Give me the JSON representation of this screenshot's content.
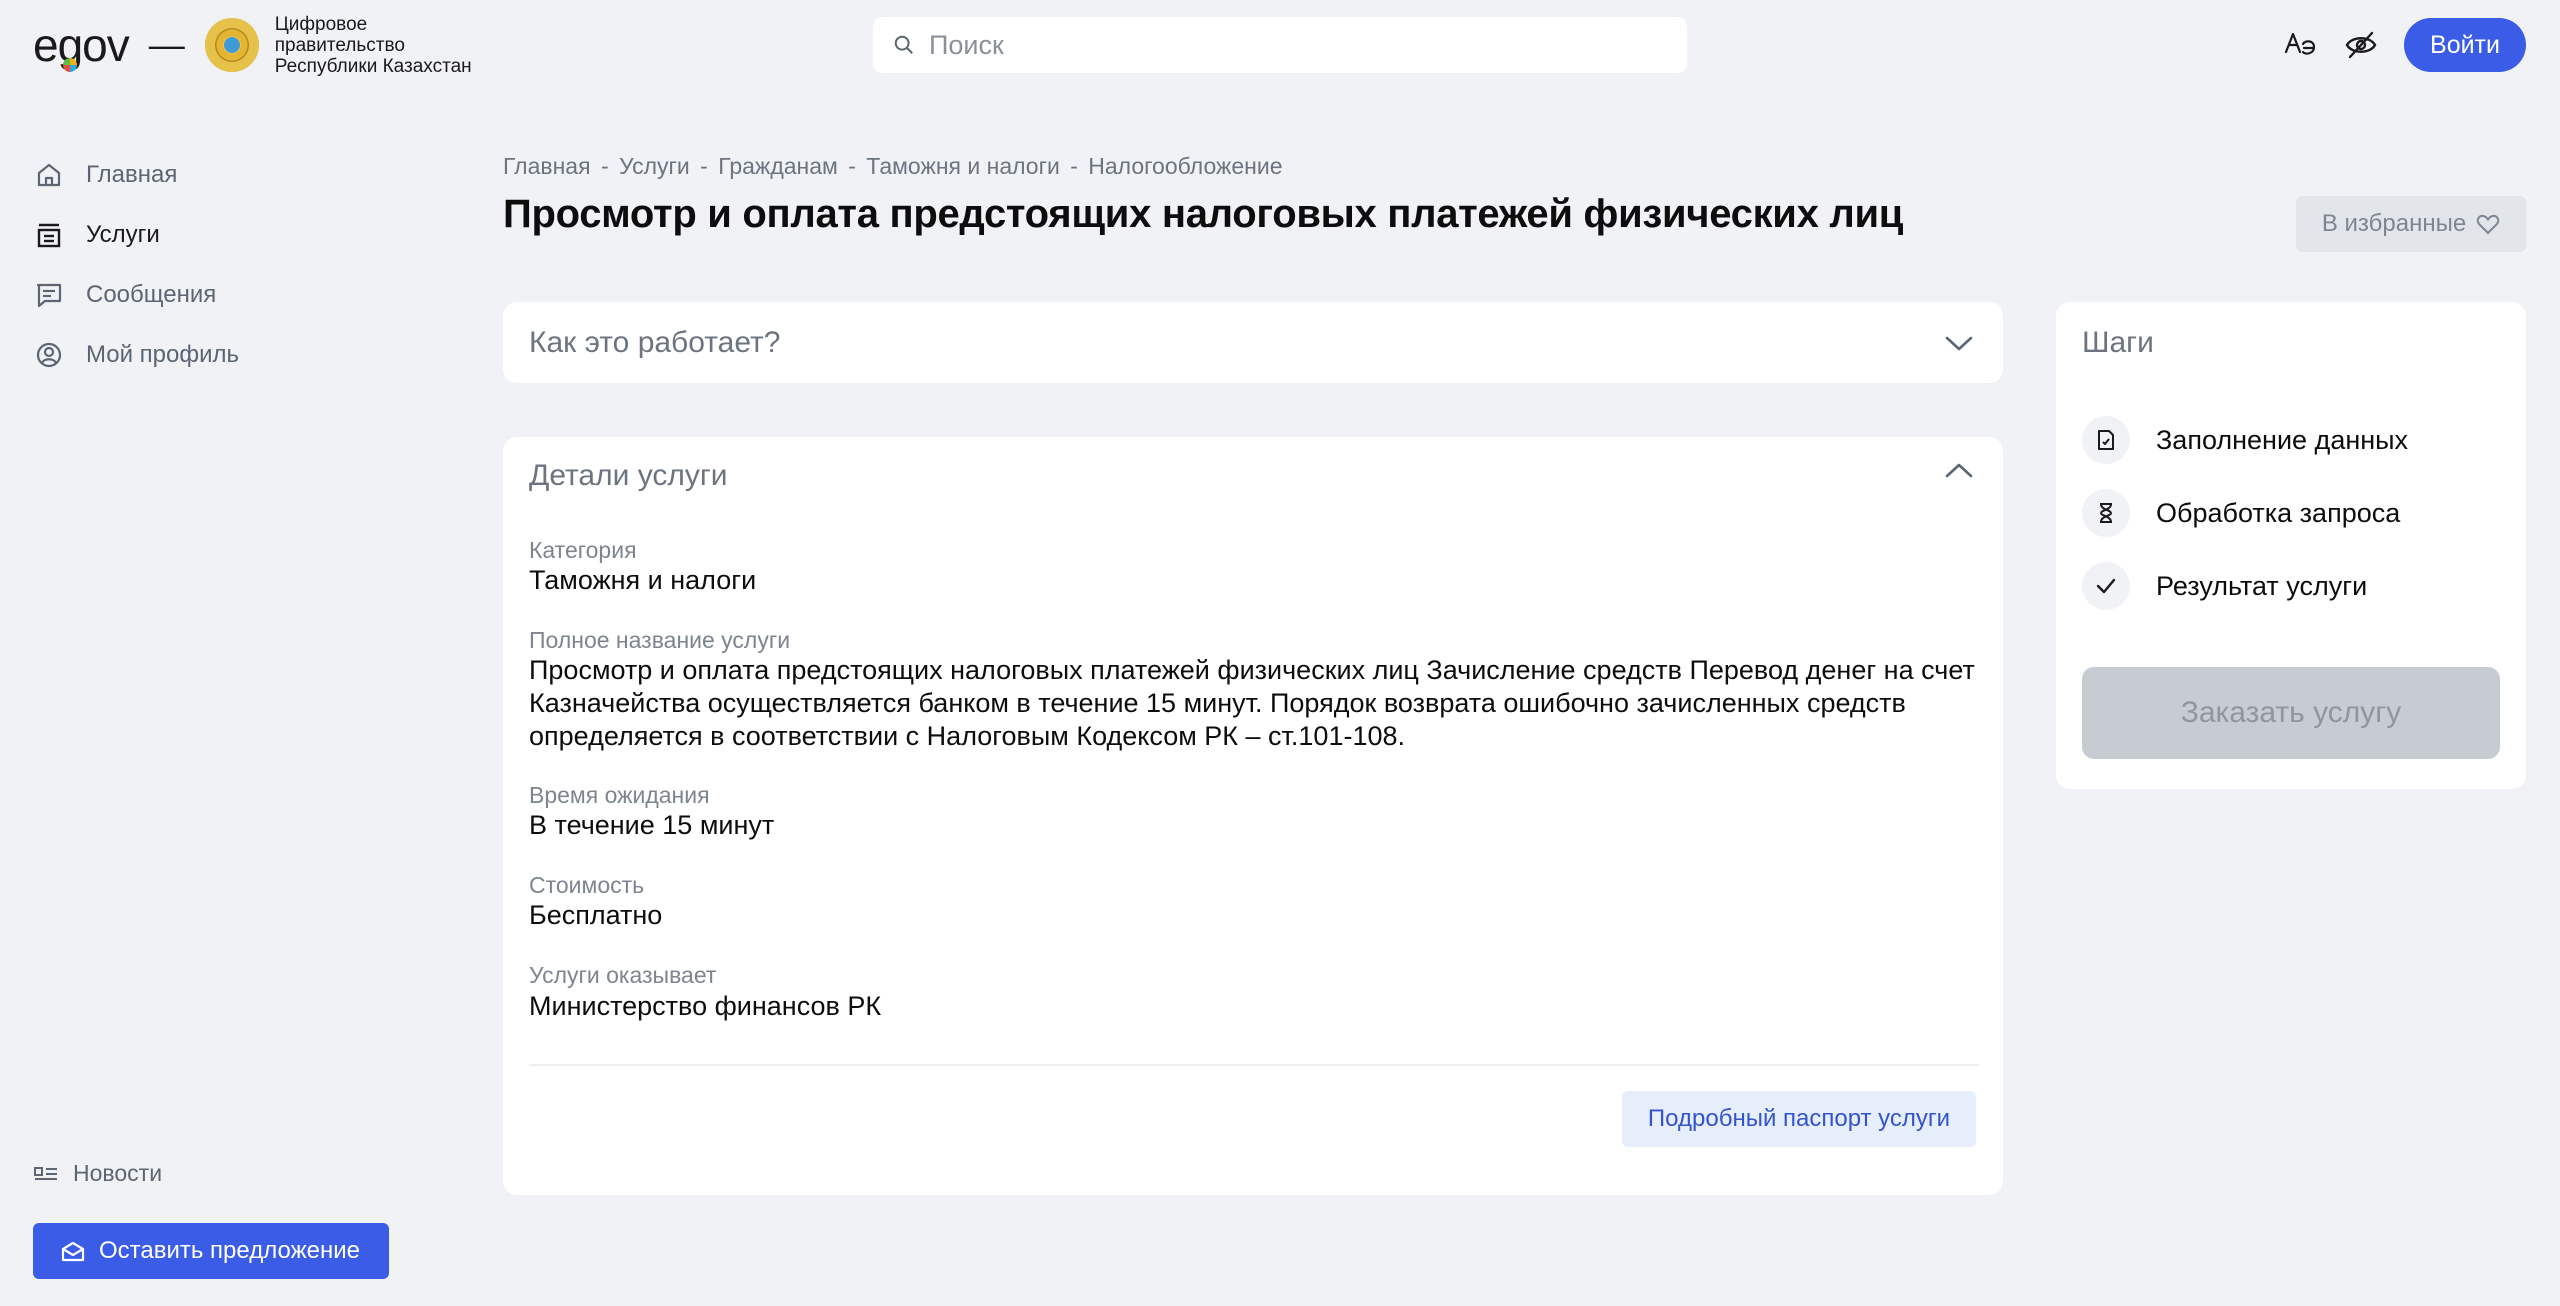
{
  "header": {
    "logo_text": "egov",
    "dash": "—",
    "gov_name_lines": [
      "Цифровое",
      "правительство",
      "Республики Казахстан"
    ],
    "search_placeholder": "Поиск",
    "login_label": "Войти"
  },
  "sidebar": {
    "items": [
      {
        "label": "Главная",
        "icon": "home-icon"
      },
      {
        "label": "Услуги",
        "icon": "services-icon"
      },
      {
        "label": "Сообщения",
        "icon": "message-icon"
      },
      {
        "label": "Мой профиль",
        "icon": "profile-icon"
      }
    ],
    "news_label": "Новости",
    "suggest_label": "Оставить предложение"
  },
  "main": {
    "breadcrumb": [
      "Главная",
      "-",
      "Услуги",
      "-",
      "Гражданам",
      "-",
      "Таможня и налоги",
      "-",
      "Налогообложение"
    ],
    "title": "Просмотр и оплата предстоящих налоговых платежей физических лиц",
    "favorite_label": "В избранные",
    "how_it_works_title": "Как это работает?",
    "details": {
      "title": "Детали услуги",
      "fields": [
        {
          "label": "Категория",
          "value": "Таможня и налоги"
        },
        {
          "label": "Полное название услуги",
          "value": "Просмотр и оплата предстоящих налоговых платежей физических лиц Зачисление средств Перевод денег на счет Казначейства осуществляется банком в течение 15 минут. Порядок возврата ошибочно зачисленных средств определяется в соответствии с Налоговым Кодексом РК – ст.101-108."
        },
        {
          "label": "Время ожидания",
          "value": "В течение 15 минут"
        },
        {
          "label": "Стоимость",
          "value": "Бесплатно"
        },
        {
          "label": "Услуги оказывает",
          "value": "Министерство финансов РК"
        }
      ],
      "passport_label": "Подробный паспорт услуги"
    }
  },
  "steps": {
    "title": "Шаги",
    "items": [
      {
        "label": "Заполнение данных",
        "icon": "form-icon"
      },
      {
        "label": "Обработка запроса",
        "icon": "hourglass-icon"
      },
      {
        "label": "Результат услуги",
        "icon": "check-icon"
      }
    ],
    "order_label": "Заказать услугу"
  },
  "colors": {
    "accent": "#3b5ce6",
    "background": "#f0f2f5",
    "card": "#ffffff",
    "disabled": "#c7ccd3"
  }
}
